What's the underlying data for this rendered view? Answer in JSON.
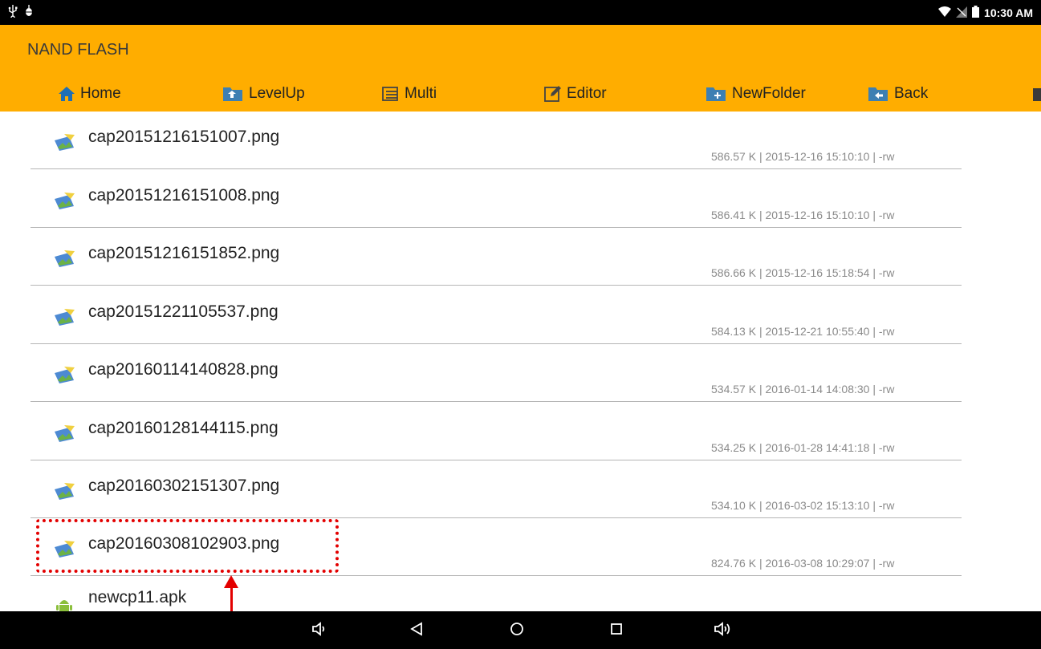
{
  "status_bar": {
    "time": "10:30 AM",
    "left_icons": [
      "usb-icon",
      "android-debug-icon"
    ],
    "right_icons": [
      "wifi-icon",
      "no-sim-icon",
      "battery-icon"
    ]
  },
  "app": {
    "title": "NAND FLASH",
    "accent_color": "#ffad00"
  },
  "toolbar": {
    "items": [
      {
        "label": "Home",
        "icon": "home-icon"
      },
      {
        "label": "LevelUp",
        "icon": "folder-levelup-icon"
      },
      {
        "label": "Multi",
        "icon": "multi-select-icon"
      },
      {
        "label": "Editor",
        "icon": "edit-icon"
      },
      {
        "label": "NewFolder",
        "icon": "new-folder-icon"
      },
      {
        "label": "Back",
        "icon": "folder-back-icon"
      }
    ]
  },
  "files": [
    {
      "name": "cap20151216151007.png",
      "meta": "586.57 K | 2015-12-16 15:10:10 | -rw",
      "icon": "image-file-icon"
    },
    {
      "name": "cap20151216151008.png",
      "meta": "586.41 K | 2015-12-16 15:10:10 | -rw",
      "icon": "image-file-icon"
    },
    {
      "name": "cap20151216151852.png",
      "meta": "586.66 K | 2015-12-16 15:18:54 | -rw",
      "icon": "image-file-icon"
    },
    {
      "name": "cap20151221105537.png",
      "meta": "584.13 K | 2015-12-21 10:55:40 | -rw",
      "icon": "image-file-icon"
    },
    {
      "name": "cap20160114140828.png",
      "meta": "534.57 K | 2016-01-14 14:08:30 | -rw",
      "icon": "image-file-icon"
    },
    {
      "name": "cap20160128144115.png",
      "meta": "534.25 K | 2016-01-28 14:41:18 | -rw",
      "icon": "image-file-icon"
    },
    {
      "name": "cap20160302151307.png",
      "meta": "534.10 K | 2016-03-02 15:13:10 | -rw",
      "icon": "image-file-icon"
    },
    {
      "name": "cap20160308102903.png",
      "meta": "824.76 K | 2016-03-08 10:29:07 | -rw",
      "icon": "image-file-icon"
    },
    {
      "name": "newcp11.apk",
      "meta": "",
      "icon": "apk-file-icon"
    }
  ],
  "nav_bar": {
    "items": [
      "volume-down-icon",
      "back-icon",
      "home-circle-icon",
      "recents-icon",
      "volume-up-icon"
    ]
  }
}
